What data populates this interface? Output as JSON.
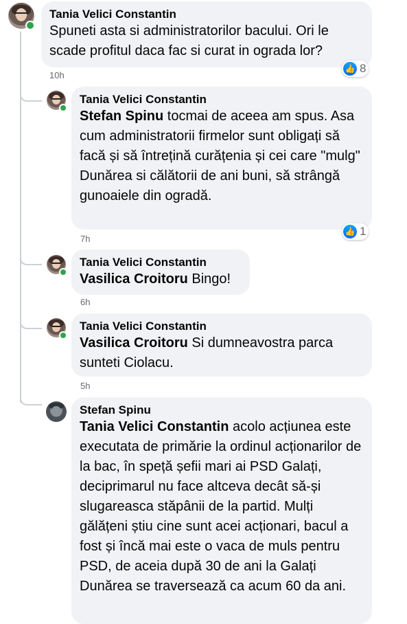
{
  "comments": [
    {
      "author": "Tania Velici Constantin",
      "text": "Spuneti asta si administratorilor bacului. Ori le scade profitul daca fac si curat in ograda lor?",
      "time": "10h",
      "reaction_count": "8"
    },
    {
      "author": "Tania Velici Constantin",
      "mention": "Stefan Spinu",
      "text": " tocmai de aceea am spus. Asa cum administratorii firmelor sunt obligați să facă și să întrețină curățenia și cei care \"mulg\" Dunărea si călătorii de ani buni, să strângă gunoaiele din ogradă.",
      "time": "7h",
      "reaction_count": "1"
    },
    {
      "author": "Tania Velici Constantin",
      "mention": "Vasilica Croitoru",
      "text": " Bingo!",
      "time": "6h"
    },
    {
      "author": "Tania Velici Constantin",
      "mention": "Vasilica Croitoru",
      "text": " Si dumneavostra parca sunteti Ciolacu.",
      "time": "5h"
    },
    {
      "author": "Stefan Spinu",
      "mention": "Tania Velici Constantin",
      "text": " acolo acțiunea este executata de primărie la ordinul acționarilor de la bac, în speță șefii mari ai PSD Galați, deciprimarul nu face altceva decât să-și slugareasca stăpânii de la partid. Mulți gălățeni știu cine sunt acei acționari, bacul a fost și încă mai este o vaca de muls pentru PSD, de aceia după 30 de ani la Galați Dunărea se traversează ca acum 60 da ani."
    }
  ],
  "icons": {
    "like": "like-thumb-icon"
  },
  "colors": {
    "bubble": "#f0f2f5",
    "online": "#31a24c",
    "like": "#0566ff"
  }
}
